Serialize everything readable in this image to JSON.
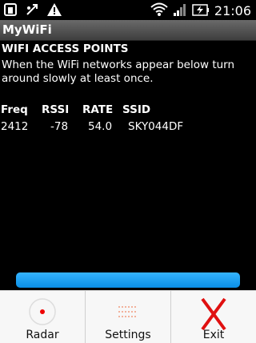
{
  "status_bar": {
    "time": "21:06",
    "left_icons": [
      "notification-icon",
      "usb-debug-icon",
      "warning-icon"
    ],
    "right_icons": [
      "wifi-icon",
      "signal-icon",
      "battery-charging-icon"
    ]
  },
  "app": {
    "title": "MyWiFi"
  },
  "main": {
    "heading": "WIFI ACCESS POINTS",
    "instruction": "When the WiFi networks appear below turn around slowly at least once.",
    "table": {
      "columns": [
        "Freq",
        "RSSI",
        "RATE",
        "SSID"
      ],
      "rows": [
        [
          "2412",
          "-78",
          "54.0",
          "SKY044DF"
        ]
      ]
    },
    "progress_color": "#1a9ff0"
  },
  "menu": {
    "items": [
      {
        "label": "Radar",
        "icon": "radar-icon"
      },
      {
        "label": "Settings",
        "icon": "settings-icon"
      },
      {
        "label": "Exit",
        "icon": "exit-x-icon"
      }
    ]
  }
}
